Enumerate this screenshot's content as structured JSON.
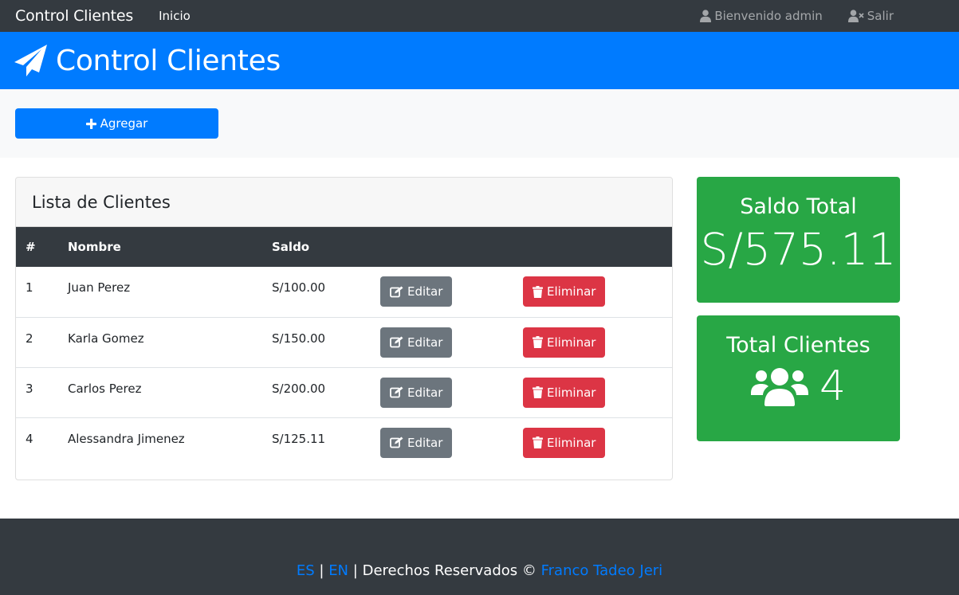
{
  "navbar": {
    "brand": "Control Clientes",
    "inicio": "Inicio",
    "welcome": "Bienvenido admin",
    "logout": "Salir"
  },
  "banner": {
    "title": "Control Clientes",
    "icon": "paper-plane-icon"
  },
  "actions": {
    "add_label": "Agregar"
  },
  "clients_card": {
    "title": "Lista de Clientes",
    "columns": [
      "#",
      "Nombre",
      "Saldo"
    ],
    "edit_label": "Editar",
    "delete_label": "Eliminar",
    "rows": [
      {
        "num": "1",
        "name": "Juan Perez",
        "saldo": "S/100.00"
      },
      {
        "num": "2",
        "name": "Karla Gomez",
        "saldo": "S/150.00"
      },
      {
        "num": "3",
        "name": "Carlos Perez",
        "saldo": "S/200.00"
      },
      {
        "num": "4",
        "name": "Alessandra Jimenez",
        "saldo": "S/125.11"
      }
    ]
  },
  "stats": {
    "saldo_title": "Saldo Total",
    "saldo_value": "S/575.11",
    "clients_title": "Total Clientes",
    "clients_value": "4"
  },
  "footer": {
    "lang_es": "ES",
    "separator": "|",
    "lang_en": "EN",
    "rights": "Derechos Reservados ©",
    "author": "Franco Tadeo Jeri"
  },
  "colors": {
    "navbar": "#343a40",
    "primary": "#007bff",
    "success": "#28a745",
    "danger": "#dc3545",
    "secondary": "#6c757d"
  }
}
